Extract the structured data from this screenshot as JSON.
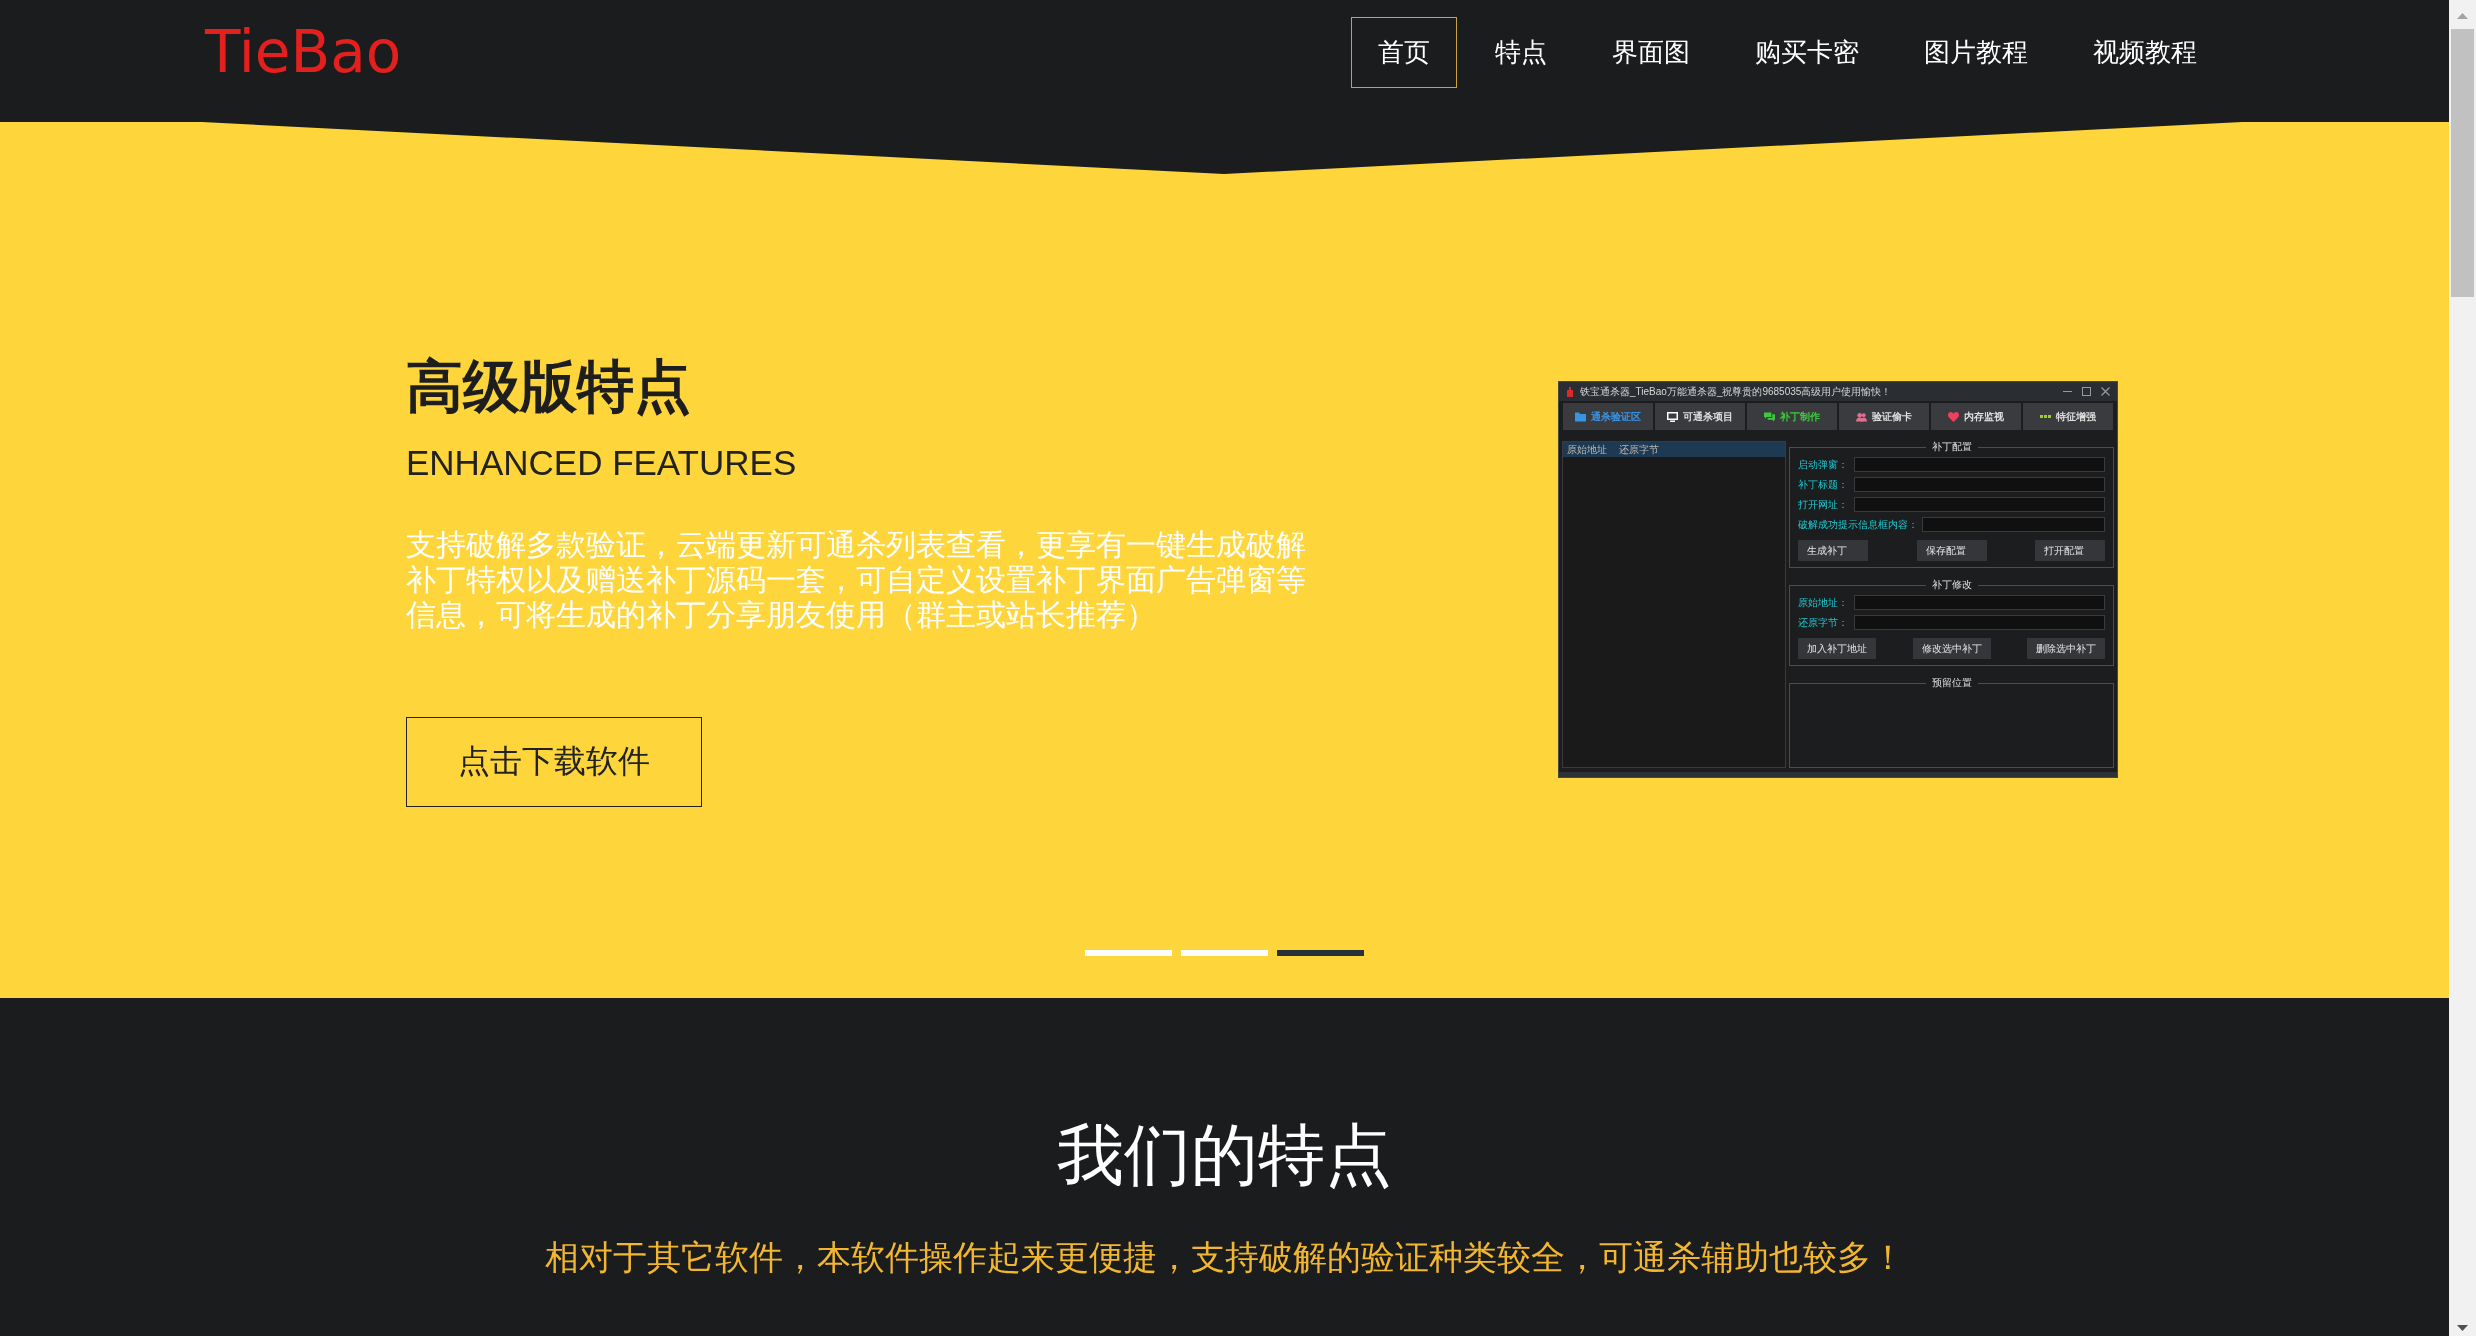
{
  "header": {
    "logo": "TieBao",
    "nav": [
      {
        "label": "首页",
        "selected": true
      },
      {
        "label": "特点",
        "selected": false
      },
      {
        "label": "界面图",
        "selected": false
      },
      {
        "label": "购买卡密",
        "selected": false
      },
      {
        "label": "图片教程",
        "selected": false
      },
      {
        "label": "视频教程",
        "selected": false
      }
    ]
  },
  "hero": {
    "title": "高级版特点",
    "subtitle": "ENHANCED FEATURES",
    "description": "支持破解多款验证，云端更新可通杀列表查看，更享有一键生成破解补丁特权以及赠送补丁源码一套，可自定义设置补丁界面广告弹窗等信息，可将生成的补丁分享朋友使用（群主或站长推荐）",
    "button": "点击下载软件",
    "screenshot": {
      "title": "铁宝通杀器_TieBao万能通杀器_祝尊贵的9685035高级用户使用愉快！",
      "tabs": [
        {
          "label": "通杀验证区",
          "color": "#3a94e6",
          "highlighted": true
        },
        {
          "label": "可通杀项目",
          "color": "#ffffff",
          "highlighted": false
        },
        {
          "label": "补丁制作",
          "color": "#3ec83e",
          "highlighted": true
        },
        {
          "label": "验证偷卡",
          "color": "#e07090",
          "highlighted": false
        },
        {
          "label": "内存监视",
          "color": "#f04060",
          "highlighted": false
        },
        {
          "label": "特征增强",
          "color": "#9acd32",
          "highlighted": false
        }
      ],
      "list_columns": [
        "原始地址",
        "还原字节"
      ],
      "groups": [
        {
          "title": "补丁配置",
          "fields": [
            {
              "label": "启动弹窗："
            },
            {
              "label": "补丁标题："
            },
            {
              "label": "打开网址："
            },
            {
              "label": "破解成功提示信息框内容："
            }
          ],
          "buttons": [
            "生成补丁",
            "保存配置",
            "打开配置"
          ]
        },
        {
          "title": "补丁修改",
          "fields": [
            {
              "label": "原始地址："
            },
            {
              "label": "还原字节："
            }
          ],
          "buttons": [
            "加入补丁地址",
            "修改选中补丁",
            "删除选中补丁"
          ]
        },
        {
          "title": "预留位置"
        }
      ]
    },
    "indicators": [
      {
        "selected": false
      },
      {
        "selected": false
      },
      {
        "selected": true
      }
    ]
  },
  "features": {
    "title": "我们的特点",
    "subtitle": "相对于其它软件，本软件操作起来更便捷，支持破解的验证种类较全，可通杀辅助也较多！"
  }
}
